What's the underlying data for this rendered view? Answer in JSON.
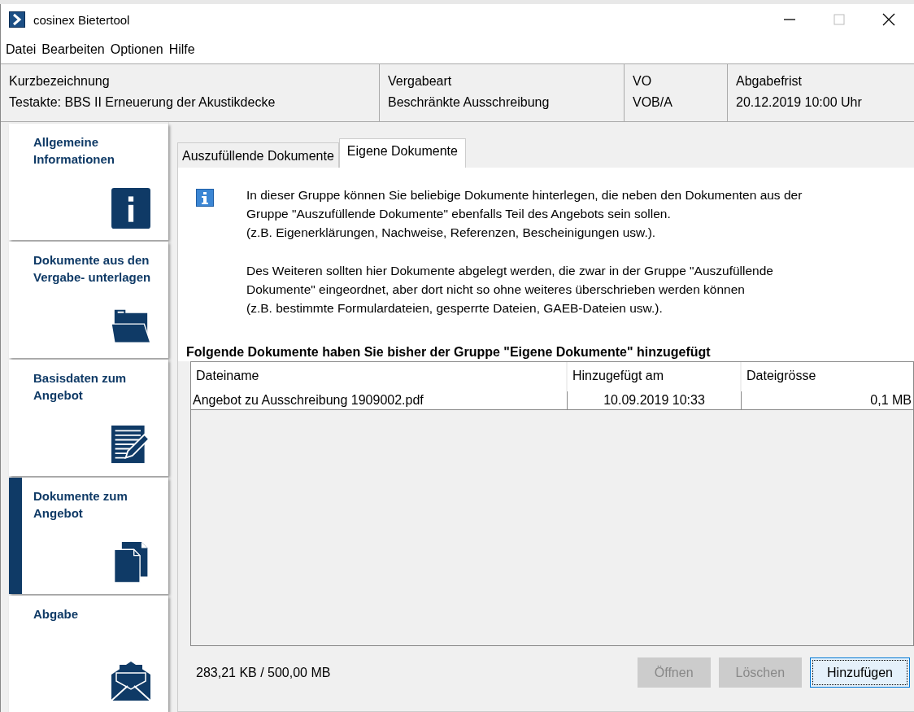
{
  "window": {
    "title": "cosinex Bietertool"
  },
  "menu": [
    "Datei",
    "Bearbeiten",
    "Optionen",
    "Hilfe"
  ],
  "header": [
    {
      "label": "Kurzbezeichnung",
      "value": "Testakte: BBS II Erneuerung der Akustikdecke"
    },
    {
      "label": "Vergabeart",
      "value": "Beschränkte Ausschreibung"
    },
    {
      "label": "VO",
      "value": "VOB/A"
    },
    {
      "label": "Abgabefrist",
      "value": "20.12.2019 10:00 Uhr"
    }
  ],
  "sidebar": {
    "items": [
      {
        "label": "Allgemeine Informationen",
        "selected": false
      },
      {
        "label": "Dokumente aus den Vergabe- unterlagen",
        "selected": false
      },
      {
        "label": "Basisdaten zum Angebot",
        "selected": false
      },
      {
        "label": "Dokumente zum Angebot",
        "selected": true
      },
      {
        "label": "Abgabe",
        "selected": false
      }
    ]
  },
  "tabs": [
    {
      "label": "Auszufüllende Dokumente",
      "selected": false
    },
    {
      "label": "Eigene Dokumente",
      "selected": true
    }
  ],
  "info": {
    "paragraphs": [
      [
        "In dieser Gruppe können Sie beliebige Dokumente hinterlegen, die neben den Dokumenten aus der",
        "Gruppe \"Auszufüllende Dokumente\" ebenfalls Teil des Angebots sein sollen.",
        "(z.B. Eigenerklärungen, Nachweise, Referenzen, Bescheinigungen usw.)."
      ],
      [
        "Des Weiteren sollten hier Dokumente abgelegt werden, die zwar in der Gruppe \"Auszufüllende",
        "Dokumente\" eingeordnet, aber dort nicht so ohne weiteres überschrieben werden können",
        "(z.B. bestimmte Formulardateien, gesperrte Dateien, GAEB-Dateien usw.)."
      ]
    ]
  },
  "table": {
    "title": "Folgende Dokumente haben Sie bisher der Gruppe \"Eigene Dokumente\" hinzugefügt",
    "columns": [
      "Dateiname",
      "Hinzugefügt am",
      "Dateigrösse"
    ],
    "rows": [
      [
        "Angebot zu Ausschreibung 1909002.pdf",
        "10.09.2019 10:33",
        "0,1 MB"
      ]
    ]
  },
  "status_bar": {
    "usage": "283,21 KB / 500,00 MB"
  },
  "buttons": [
    {
      "label": "Öffnen",
      "disabled": true
    },
    {
      "label": "Löschen",
      "disabled": true
    },
    {
      "label": "Hinzufügen",
      "disabled": false
    }
  ]
}
